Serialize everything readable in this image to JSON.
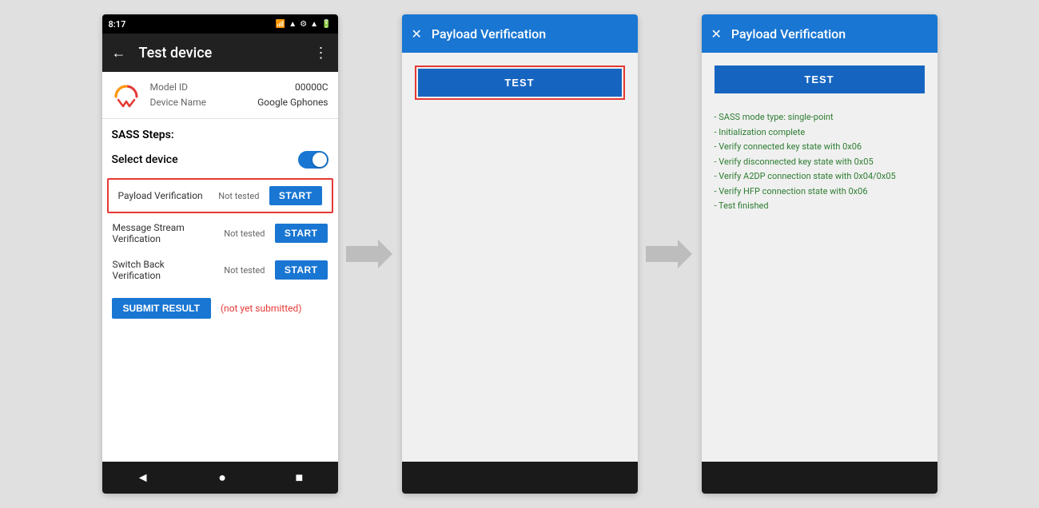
{
  "screen1": {
    "status_bar": {
      "time": "8:17",
      "icons": [
        "sim",
        "wifi",
        "settings",
        "signal",
        "battery"
      ]
    },
    "app_bar": {
      "title": "Test device",
      "back_label": "←",
      "more_label": "⋮"
    },
    "device_info": {
      "model_id_label": "Model ID",
      "model_id_value": "00000C",
      "device_name_label": "Device Name",
      "device_name_value": "Google Gphones"
    },
    "sass_steps_title": "SASS Steps:",
    "select_device_label": "Select device",
    "steps": [
      {
        "name": "Payload Verification",
        "status": "Not tested",
        "button": "START",
        "highlighted": true
      },
      {
        "name": "Message Stream Verification",
        "status": "Not tested",
        "button": "START",
        "highlighted": false
      },
      {
        "name": "Switch Back Verification",
        "status": "Not tested",
        "button": "START",
        "highlighted": false
      }
    ],
    "submit_btn_label": "SUBMIT RESULT",
    "submit_status": "(not yet submitted)",
    "nav": {
      "back": "◄",
      "home": "●",
      "recent": "■"
    }
  },
  "screen2": {
    "dialog_title": "Payload Verification",
    "close_icon": "✕",
    "test_button_label": "TEST"
  },
  "screen3": {
    "dialog_title": "Payload Verification",
    "close_icon": "✕",
    "test_button_label": "TEST",
    "result_lines": [
      "- SASS mode type: single-point",
      "- Initialization complete",
      "- Verify connected key state with 0x06",
      "- Verify disconnected key state with 0x05",
      "- Verify A2DP connection state with 0x04/0x05",
      "- Verify HFP connection state with 0x06",
      "- Test finished"
    ]
  },
  "arrows": {
    "color": "#bdbdbd"
  }
}
